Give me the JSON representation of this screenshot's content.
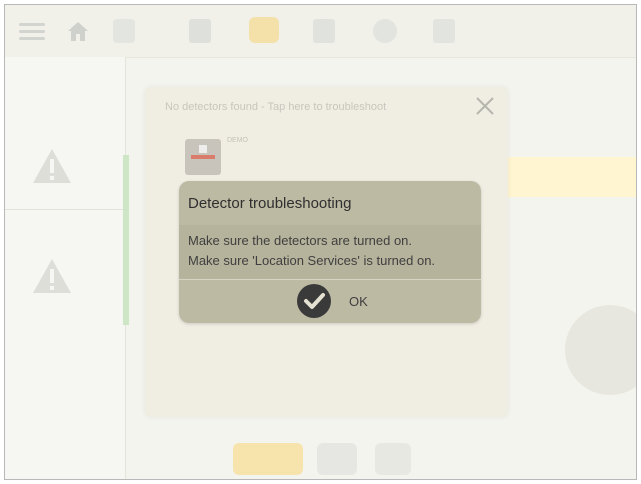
{
  "panel": {
    "title": "No detectors found - Tap here to troubleshoot",
    "demo_label": "DEMO"
  },
  "dialog": {
    "title": "Detector troubleshooting",
    "messages": [
      "Make sure the detectors are turned on.",
      "Make sure 'Location Services' is turned on."
    ],
    "ok_label": "OK"
  },
  "colors": {
    "dialog_bg": "#bdbaa4",
    "accent_yellow": "#f7cf5a"
  },
  "icons": {
    "close": "close-icon",
    "ok": "checkmark-icon",
    "menu": "hamburger-icon",
    "home": "home-icon",
    "warning": "warning-icon"
  }
}
